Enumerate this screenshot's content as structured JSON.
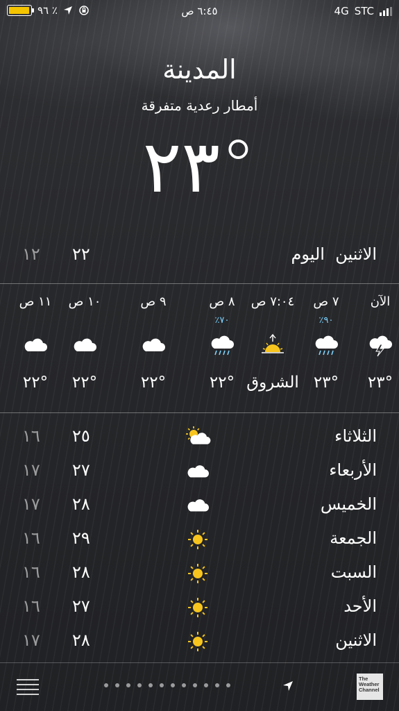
{
  "status_bar": {
    "battery_percent": "٩٦ ٪",
    "time": "٦:٤٥ ص",
    "network": "4G",
    "carrier": "STC",
    "battery_level": 0.96
  },
  "header": {
    "city": "المدينة",
    "condition": "أمطار رعدية متفرقة",
    "temperature": "٢٣°"
  },
  "today": {
    "day": "الاثنين",
    "label": "اليوم",
    "high": "٢٢",
    "low": "١٢"
  },
  "hourly": [
    {
      "time": "الآن",
      "pct": "",
      "icon": "thunderstorm-icon",
      "temp": "٢٣°"
    },
    {
      "time": "٧ ص",
      "pct": "٪٩٠",
      "icon": "rain-icon",
      "temp": "٢٣°"
    },
    {
      "time": "٧:٠٤ ص",
      "pct": "",
      "icon": "sunrise-icon",
      "temp": "الشروق"
    },
    {
      "time": "٨ ص",
      "pct": "٪٧٠",
      "icon": "rain-icon",
      "temp": "٢٢°"
    },
    {
      "time": "٩ ص",
      "pct": "",
      "icon": "cloud-icon",
      "temp": "٢٢°"
    },
    {
      "time": "١٠ ص",
      "pct": "",
      "icon": "cloud-icon",
      "temp": "٢٢°"
    },
    {
      "time": "١١ ص",
      "pct": "",
      "icon": "cloud-icon",
      "temp": "٢٢°"
    }
  ],
  "daily": [
    {
      "day": "الثلاثاء",
      "icon": "partly-cloudy-icon",
      "high": "٢٥",
      "low": "١٦"
    },
    {
      "day": "الأربعاء",
      "icon": "cloud-icon",
      "high": "٢٧",
      "low": "١٧"
    },
    {
      "day": "الخميس",
      "icon": "cloud-icon",
      "high": "٢٨",
      "low": "١٧"
    },
    {
      "day": "الجمعة",
      "icon": "sun-icon",
      "high": "٢٩",
      "low": "١٦"
    },
    {
      "day": "السبت",
      "icon": "sun-icon",
      "high": "٢٨",
      "low": "١٦"
    },
    {
      "day": "الأحد",
      "icon": "sun-icon",
      "high": "٢٧",
      "low": "١٦"
    },
    {
      "day": "الاثنين",
      "icon": "sun-icon",
      "high": "٢٨",
      "low": "١٧"
    }
  ],
  "bottom_bar": {
    "page_count": 12,
    "logo_text": "The Weather Channel"
  },
  "colors": {
    "precip": "#7fd3ff",
    "sun": "#f7c51e",
    "battery": "#f5c400"
  }
}
